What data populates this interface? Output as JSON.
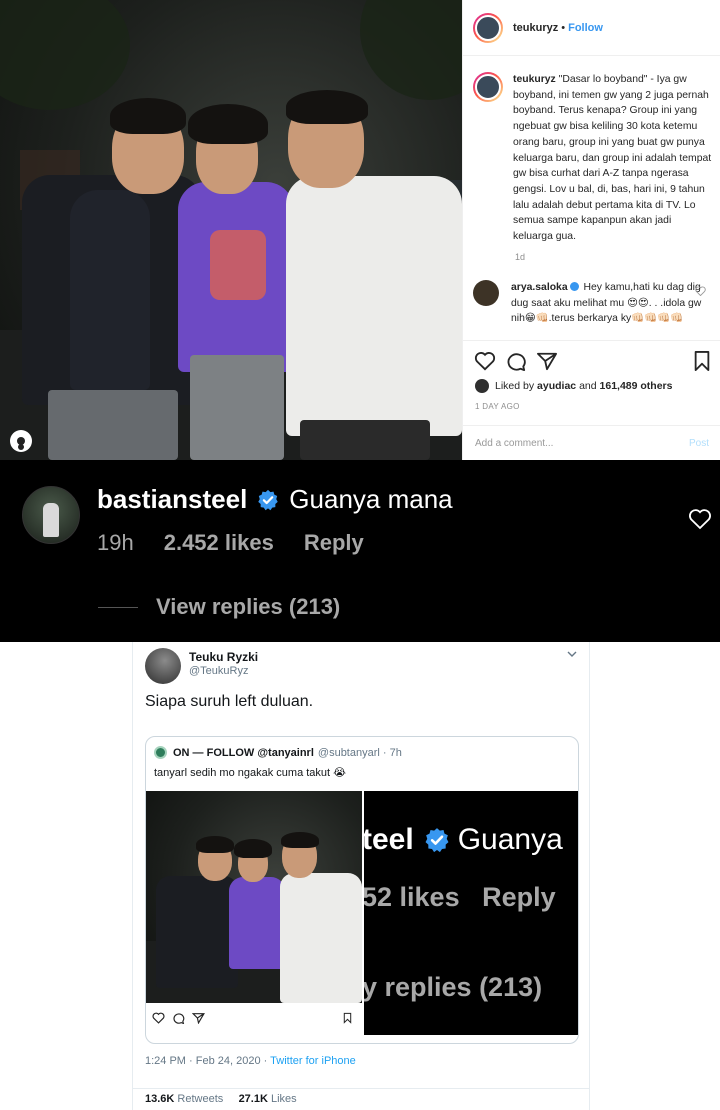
{
  "instagram_post": {
    "username": "teukuryz",
    "separator": "•",
    "follow_label": "Follow",
    "caption_username": "teukuryz",
    "caption_text": "\"Dasar lo boyband\" - Iya gw boyband, ini temen gw yang 2 juga pernah boyband. Terus kenapa? Group ini yang ngebuat gw bisa keliling 30 kota ketemu orang baru, group ini yang buat gw punya keluarga baru, dan group ini adalah tempat gw bisa curhat dari A-Z tanpa ngerasa gengsi. Lov u bal, di, bas, hari ini, 9 tahun lalu adalah debut pertama kita di TV. Lo semua sampe kapanpun akan jadi keluarga gua.",
    "caption_time": "1d",
    "comment": {
      "username": "arya.saloka",
      "text": "Hey kamu,hati ku dag dig dug saat aku melihat mu 😍😍. . .idola gw nih😁👊🏻.terus berkarya ky👊🏻👊🏻👊🏻👊🏻"
    },
    "liked_by_prefix": "Liked by",
    "liked_by_user": "ayudiac",
    "liked_by_and": "and",
    "liked_by_count": "161,489 others",
    "date": "1 DAY AGO",
    "add_comment_placeholder": "Add a comment...",
    "post_label": "Post",
    "icons": [
      "heart-icon",
      "comment-icon",
      "share-icon",
      "bookmark-icon",
      "user-tag-icon"
    ]
  },
  "dark_comment": {
    "username": "bastiansteel",
    "text": "Guanya mana",
    "time": "19h",
    "likes": "2.452 likes",
    "reply_label": "Reply",
    "view_replies": "View replies (213)",
    "colors": {
      "background": "#000000",
      "secondary_text": "#a8a8a8",
      "verified": "#3897f0"
    }
  },
  "tweet": {
    "name": "Teuku Ryzki",
    "handle": "@TeukuRyz",
    "text": "Siapa suruh left duluan.",
    "quote": {
      "name": "ON — FOLLOW @tanyainrl",
      "handle": "@subtanyarl · 7h",
      "text": "tanyarl sedih mo ngakak cuma takut 😭",
      "right_image": {
        "line1_user": "teel",
        "line1_text": "Guanya",
        "line2": "52 likes   Reply",
        "line3": "y replies (213)"
      }
    },
    "timestamp": "1:24 PM · Feb 24, 2020 · ",
    "source": "Twitter for iPhone",
    "retweets_count": "13.6K",
    "retweets_label": "Retweets",
    "likes_count": "27.1K",
    "likes_label": "Likes",
    "colors": {
      "link": "#1da1f2",
      "muted": "#657786"
    }
  }
}
